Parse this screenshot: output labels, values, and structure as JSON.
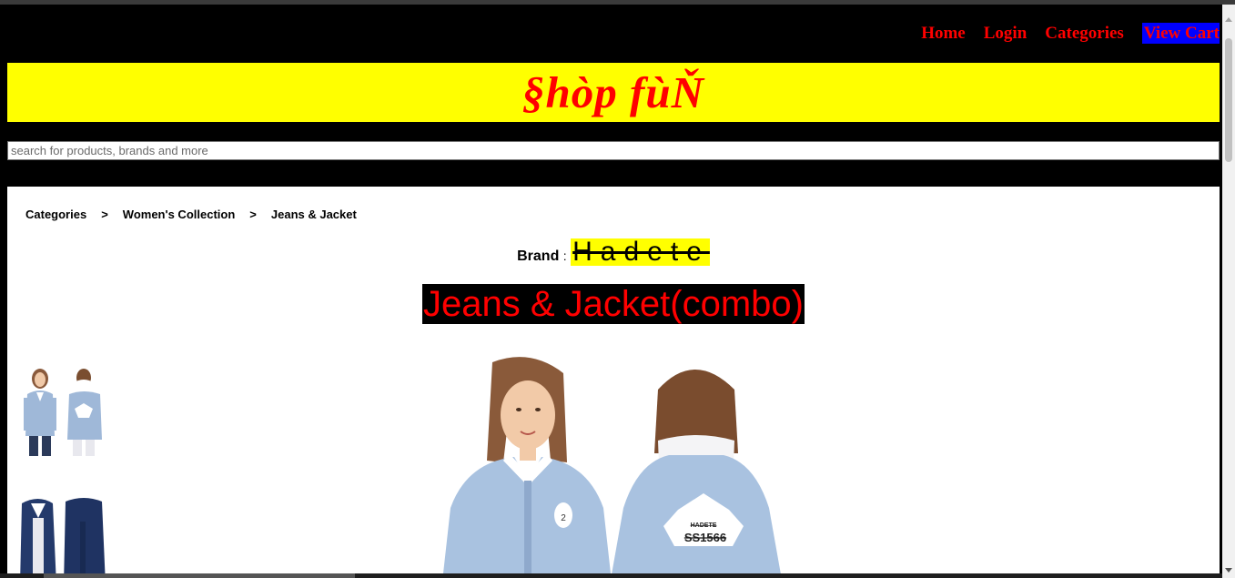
{
  "nav": {
    "home": "Home",
    "login": "Login",
    "categories": "Categories",
    "view_cart": "View Cart"
  },
  "colors": {
    "background": "#000000",
    "accent_red": "#ff0000",
    "banner_yellow": "#ffff00",
    "cart_blue": "#0000ff"
  },
  "banner": {
    "logo": "§hòp fùŇ"
  },
  "search": {
    "placeholder": "search for products, brands and more"
  },
  "breadcrumb": {
    "items": [
      "Categories",
      "Women's Collection",
      "Jeans & Jacket"
    ],
    "separator": ">"
  },
  "product": {
    "brand_label": "Brand",
    "brand_colon": ":",
    "brand_name": "Hadete",
    "title": "Jeans & Jacket(combo)",
    "print_brand": "HADETE",
    "print_code": "SS1566"
  },
  "icons": {
    "scroll_up": "chevron-up-icon",
    "scroll_down": "chevron-down-icon"
  }
}
